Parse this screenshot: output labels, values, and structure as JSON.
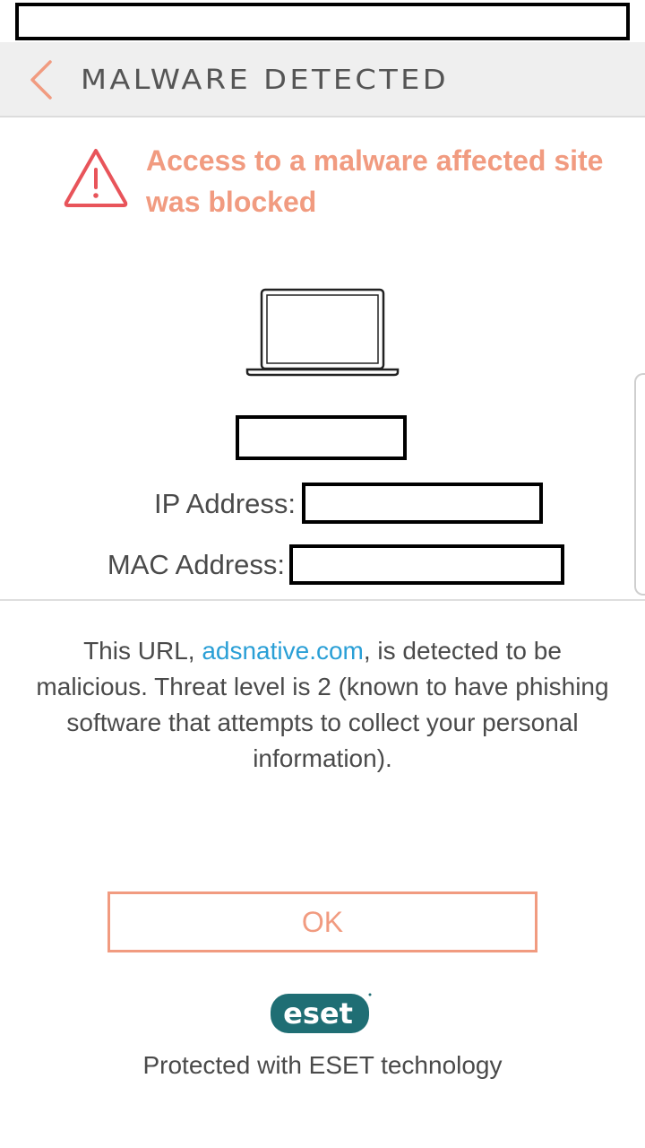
{
  "header": {
    "title": "MALWARE DETECTED",
    "back_icon": "chevron-left-icon"
  },
  "alert": {
    "icon": "warning-triangle-icon",
    "message": "Access to a malware affected site was blocked"
  },
  "device": {
    "icon": "laptop-icon",
    "ip_label": "IP Address:",
    "mac_label": "MAC Address:"
  },
  "description": {
    "prefix": "This URL, ",
    "url": "adsnative.com",
    "suffix": ", is detected to be malicious. Threat level is 2 (known to have phishing software that attempts to collect your personal information)."
  },
  "actions": {
    "ok_label": "OK"
  },
  "footer": {
    "logo_text": "eset",
    "protected_text": "Protected with ESET technology"
  },
  "colors": {
    "accent": "#f19b80",
    "warning_red": "#e8545a",
    "link": "#2a9fd6",
    "logo_teal": "#1f6e74",
    "header_bg": "#efefef"
  }
}
